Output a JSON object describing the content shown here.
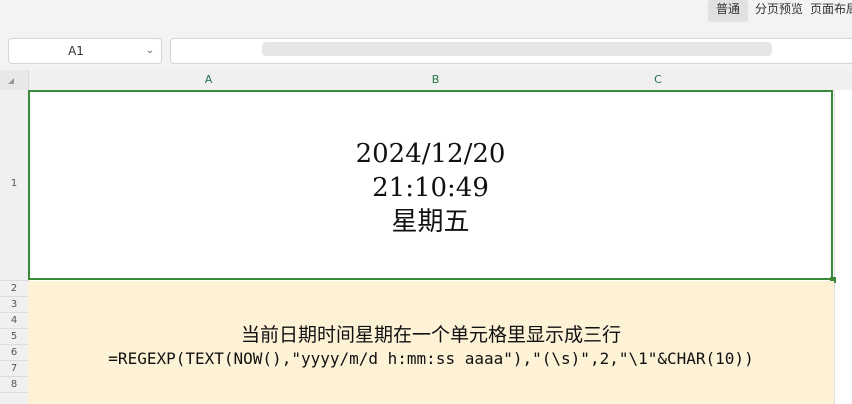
{
  "view_modes": {
    "normal": "普通",
    "page_break": "分页预览",
    "page_layout": "页面布局"
  },
  "name_box": {
    "value": "A1"
  },
  "formula_bar": {
    "value": ""
  },
  "columns": [
    "A",
    "B",
    "C"
  ],
  "rows": [
    "1",
    "2",
    "3",
    "4",
    "5",
    "6",
    "7",
    "8"
  ],
  "cell_a1": {
    "date": "2024/12/20",
    "time": "21:10:49",
    "weekday": "星期五"
  },
  "note": {
    "title": "当前日期时间星期在一个单元格里显示成三行",
    "formula": "=REGEXP(TEXT(NOW(),\"yyyy/m/d h:mm:ss aaaa\"),\"(\\s)\",2,\"\\1\"&CHAR(10))"
  },
  "colors": {
    "selection": "#3a8a3a",
    "header_text": "#217346",
    "note_fill": "#fdf1d6"
  }
}
